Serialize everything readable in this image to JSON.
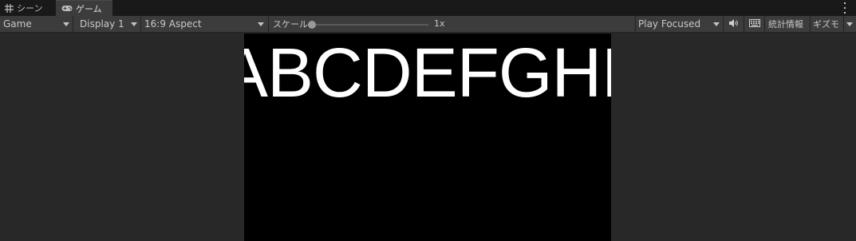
{
  "tabs": [
    {
      "label": "シーン",
      "icon": "grid-icon",
      "active": false
    },
    {
      "label": "ゲーム",
      "icon": "gamepad-icon",
      "active": true
    }
  ],
  "toolbar": {
    "display_mode": "Game",
    "display": "Display 1",
    "aspect": "16:9 Aspect",
    "scale_label": "スケール",
    "scale_value": "1x",
    "scale_level": 0.0,
    "play_mode": "Play Focused",
    "mute_icon": "speaker-icon",
    "keyboard_icon": "keyboard-icon",
    "stats_label": "統計情報",
    "gizmos_label": "ギズモ"
  },
  "game_view": {
    "text": "ABCDEFGHIJ",
    "background": "#000000",
    "text_color": "#ffffff"
  },
  "colors": {
    "tab_bar": "#191919",
    "toolbar": "#3c3c3c",
    "panel": "#282828"
  }
}
